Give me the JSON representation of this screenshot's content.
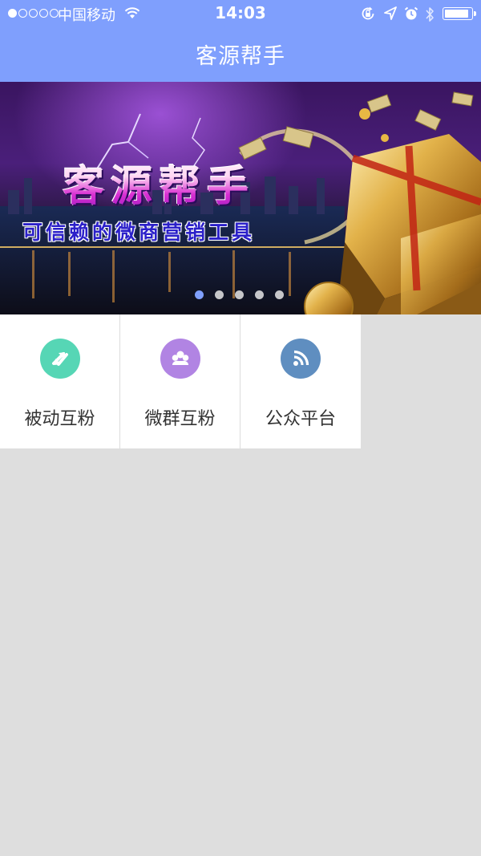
{
  "status_bar": {
    "carrier": "中国移动",
    "time": "14:03",
    "signal_bars": 1,
    "signal_total": 5,
    "battery_level": 0.9
  },
  "nav": {
    "title": "客源帮手"
  },
  "banner": {
    "title": "客源帮手",
    "slogan": "可信赖的微商营销工具",
    "slides": 5,
    "active_slide": 0
  },
  "menu": [
    {
      "label": "被动互粉",
      "icon": "refresh-arrows-icon",
      "color": "#56d6b5"
    },
    {
      "label": "微群互粉",
      "icon": "group-icon",
      "color": "#b184e3"
    },
    {
      "label": "公众平台",
      "icon": "rss-feed-icon",
      "color": "#5f8ec0"
    }
  ],
  "colors": {
    "accent": "#7f9ffd",
    "background": "#dedede"
  }
}
